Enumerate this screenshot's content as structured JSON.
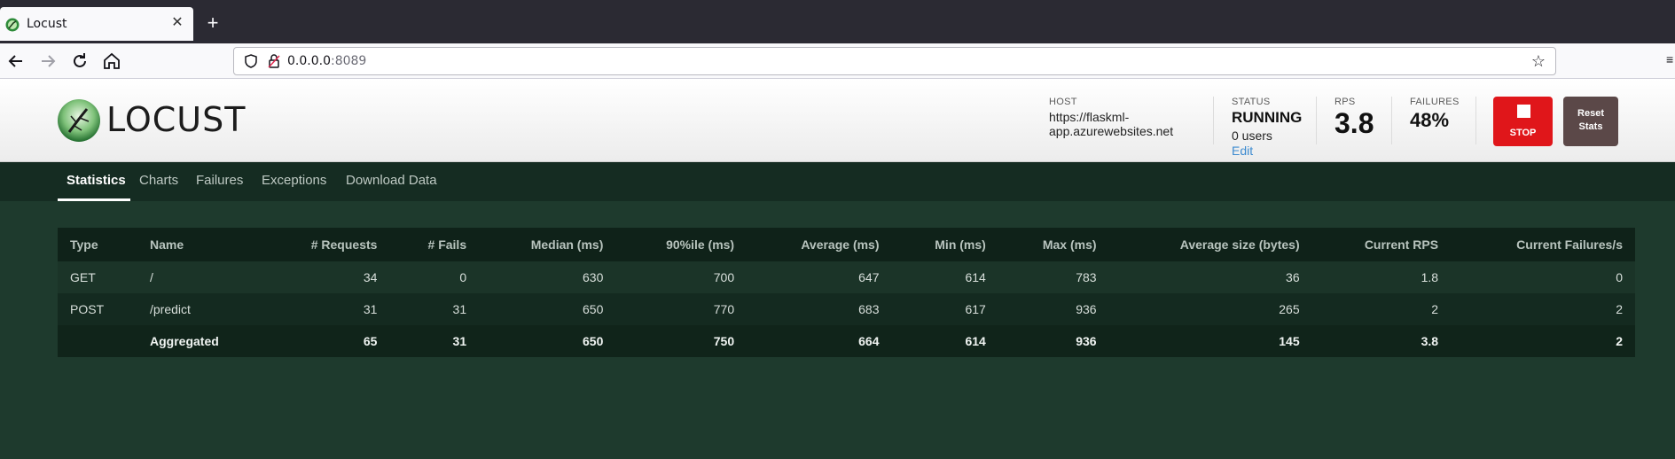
{
  "browser": {
    "tab_title": "Locust",
    "tab_close": "✕",
    "new_tab": "+",
    "url_host": "0.0.0.0",
    "url_port": ":8089"
  },
  "header": {
    "logo_text": "LOCUST",
    "host_label": "HOST",
    "host_value": "https://flaskml-app.azurewebsites.net",
    "status_label": "STATUS",
    "status_value": "RUNNING",
    "status_users": "0 users",
    "status_edit": "Edit",
    "rps_label": "RPS",
    "rps_value": "3.8",
    "failures_label": "FAILURES",
    "failures_value": "48%",
    "stop_label": "STOP",
    "reset_label_line1": "Reset",
    "reset_label_line2": "Stats",
    "accent_stop": "#e0161a",
    "accent_reset": "#5b4848"
  },
  "menu": {
    "items": [
      "Statistics",
      "Charts",
      "Failures",
      "Exceptions",
      "Download Data"
    ],
    "active": "Statistics"
  },
  "table": {
    "headers": [
      "Type",
      "Name",
      "# Requests",
      "# Fails",
      "Median (ms)",
      "90%ile (ms)",
      "Average (ms)",
      "Min (ms)",
      "Max (ms)",
      "Average size (bytes)",
      "Current RPS",
      "Current Failures/s"
    ],
    "rows": [
      [
        "GET",
        "/",
        "34",
        "0",
        "630",
        "700",
        "647",
        "614",
        "783",
        "36",
        "1.8",
        "0"
      ],
      [
        "POST",
        "/predict",
        "31",
        "31",
        "650",
        "770",
        "683",
        "617",
        "936",
        "265",
        "2",
        "2"
      ]
    ],
    "aggregated": [
      "",
      "Aggregated",
      "65",
      "31",
      "650",
      "750",
      "664",
      "614",
      "936",
      "145",
      "3.8",
      "2"
    ]
  }
}
